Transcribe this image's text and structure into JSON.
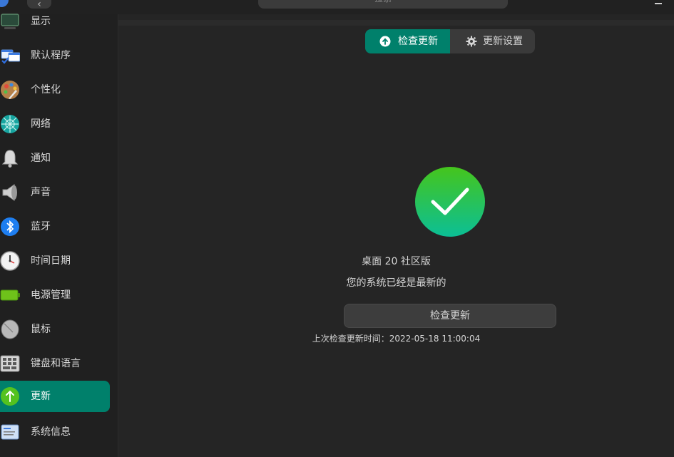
{
  "topbar": {
    "search_placeholder": "搜索"
  },
  "sidebar": {
    "items": [
      {
        "label": "显示",
        "icon": "display-icon"
      },
      {
        "label": "默认程序",
        "icon": "default-apps-icon"
      },
      {
        "label": "个性化",
        "icon": "personalization-icon"
      },
      {
        "label": "网络",
        "icon": "network-icon"
      },
      {
        "label": "通知",
        "icon": "bell-icon"
      },
      {
        "label": "声音",
        "icon": "speaker-icon"
      },
      {
        "label": "蓝牙",
        "icon": "bluetooth-icon"
      },
      {
        "label": "时间日期",
        "icon": "clock-icon"
      },
      {
        "label": "电源管理",
        "icon": "battery-icon"
      },
      {
        "label": "鼠标",
        "icon": "mouse-icon"
      },
      {
        "label": "键盘和语言",
        "icon": "keyboard-icon"
      },
      {
        "label": "更新",
        "icon": "update-icon",
        "active": true
      },
      {
        "label": "系统信息",
        "icon": "system-info-icon"
      }
    ]
  },
  "tabs": {
    "check_update": "检查更新",
    "update_settings": "更新设置"
  },
  "status": {
    "product": "桌面 20 社区版",
    "message": "您的系统已经是最新的"
  },
  "actions": {
    "check_update_button": "检查更新"
  },
  "last_check": "上次检查更新时间：2022-05-18 11:00:04",
  "colors": {
    "accent": "#00806b",
    "success_green": "#2fc15a"
  }
}
